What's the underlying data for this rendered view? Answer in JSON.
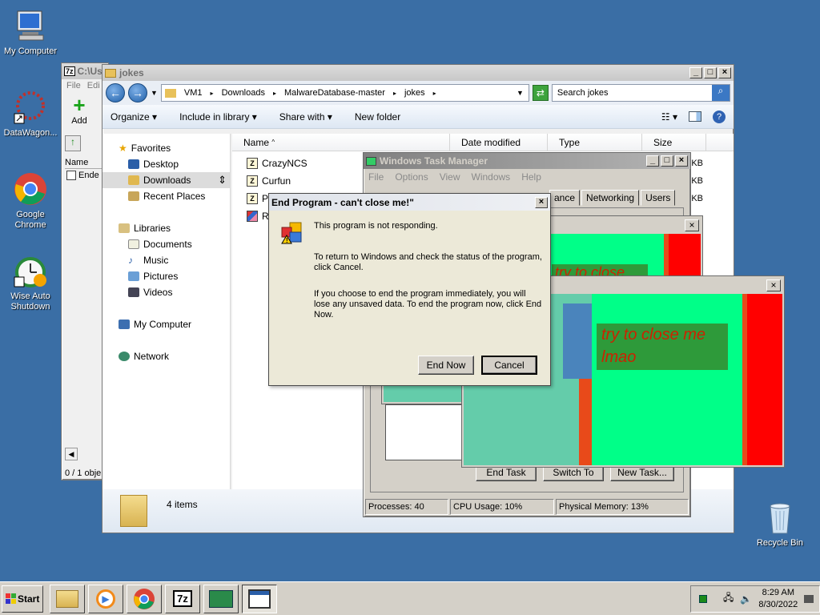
{
  "desktop": {
    "icons": [
      {
        "label": "My Computer"
      },
      {
        "label": "DataWagon..."
      },
      {
        "label": "Google Chrome"
      },
      {
        "label": "Wise Auto Shutdown"
      },
      {
        "label": "Recycle Bin"
      }
    ]
  },
  "sevenzip": {
    "title": "C:\\Us",
    "menu": [
      "File",
      "Edi"
    ],
    "add_label": "Add",
    "col_name": "Name",
    "row": "Ende",
    "status": "0 / 1 obje"
  },
  "explorer": {
    "title": "jokes",
    "breadcrumb": [
      "VM1",
      "Downloads",
      "MalwareDatabase-master",
      "jokes"
    ],
    "search_placeholder": "Search jokes",
    "toolbar": {
      "organize": "Organize",
      "include": "Include in library",
      "share": "Share with",
      "new_folder": "New folder"
    },
    "nav": {
      "favorites": "Favorites",
      "desktop": "Desktop",
      "downloads": "Downloads",
      "recent": "Recent Places",
      "libraries": "Libraries",
      "documents": "Documents",
      "music": "Music",
      "pictures": "Pictures",
      "videos": "Videos",
      "mycomputer": "My Computer",
      "network": "Network"
    },
    "columns": {
      "name": "Name",
      "modified": "Date modified",
      "type": "Type",
      "size": "Size"
    },
    "files": [
      "CrazyNCS",
      "Curfun",
      "Po",
      "Ra"
    ],
    "size_suffix": [
      "KB",
      "KB",
      "KB"
    ],
    "details": "4 items"
  },
  "taskmgr": {
    "title": "Windows Task Manager",
    "menu": [
      "File",
      "Options",
      "View",
      "Windows",
      "Help"
    ],
    "tabs": [
      "ance",
      "Networking",
      "Users"
    ],
    "buttons": {
      "end_task": "End Task",
      "switch_to": "Switch To",
      "new_task": "New Task..."
    },
    "status": {
      "processes": "Processes: 40",
      "cpu": "CPU Usage: 10%",
      "memory": "Physical Memory: 13%"
    }
  },
  "prank": {
    "text_line1": "try to close me",
    "text_line2": "lmao",
    "partial_text": "try to close me"
  },
  "dialog": {
    "title": "End Program - can't close me!\"",
    "line1": "This program is not responding.",
    "line2": "To return to Windows and check the status of the program, click Cancel.",
    "line3": "If you choose to end the program immediately, you will lose any unsaved data. To end the program now, click End Now.",
    "end_now": "End Now",
    "cancel": "Cancel"
  },
  "taskbar": {
    "start": "Start",
    "time": "8:29 AM",
    "date": "8/30/2022"
  },
  "colors": {
    "desktop": "#3a6ea5",
    "prank_green": "#00ff88",
    "prank_red": "#ff0000",
    "prank_text": "#cc2200"
  }
}
